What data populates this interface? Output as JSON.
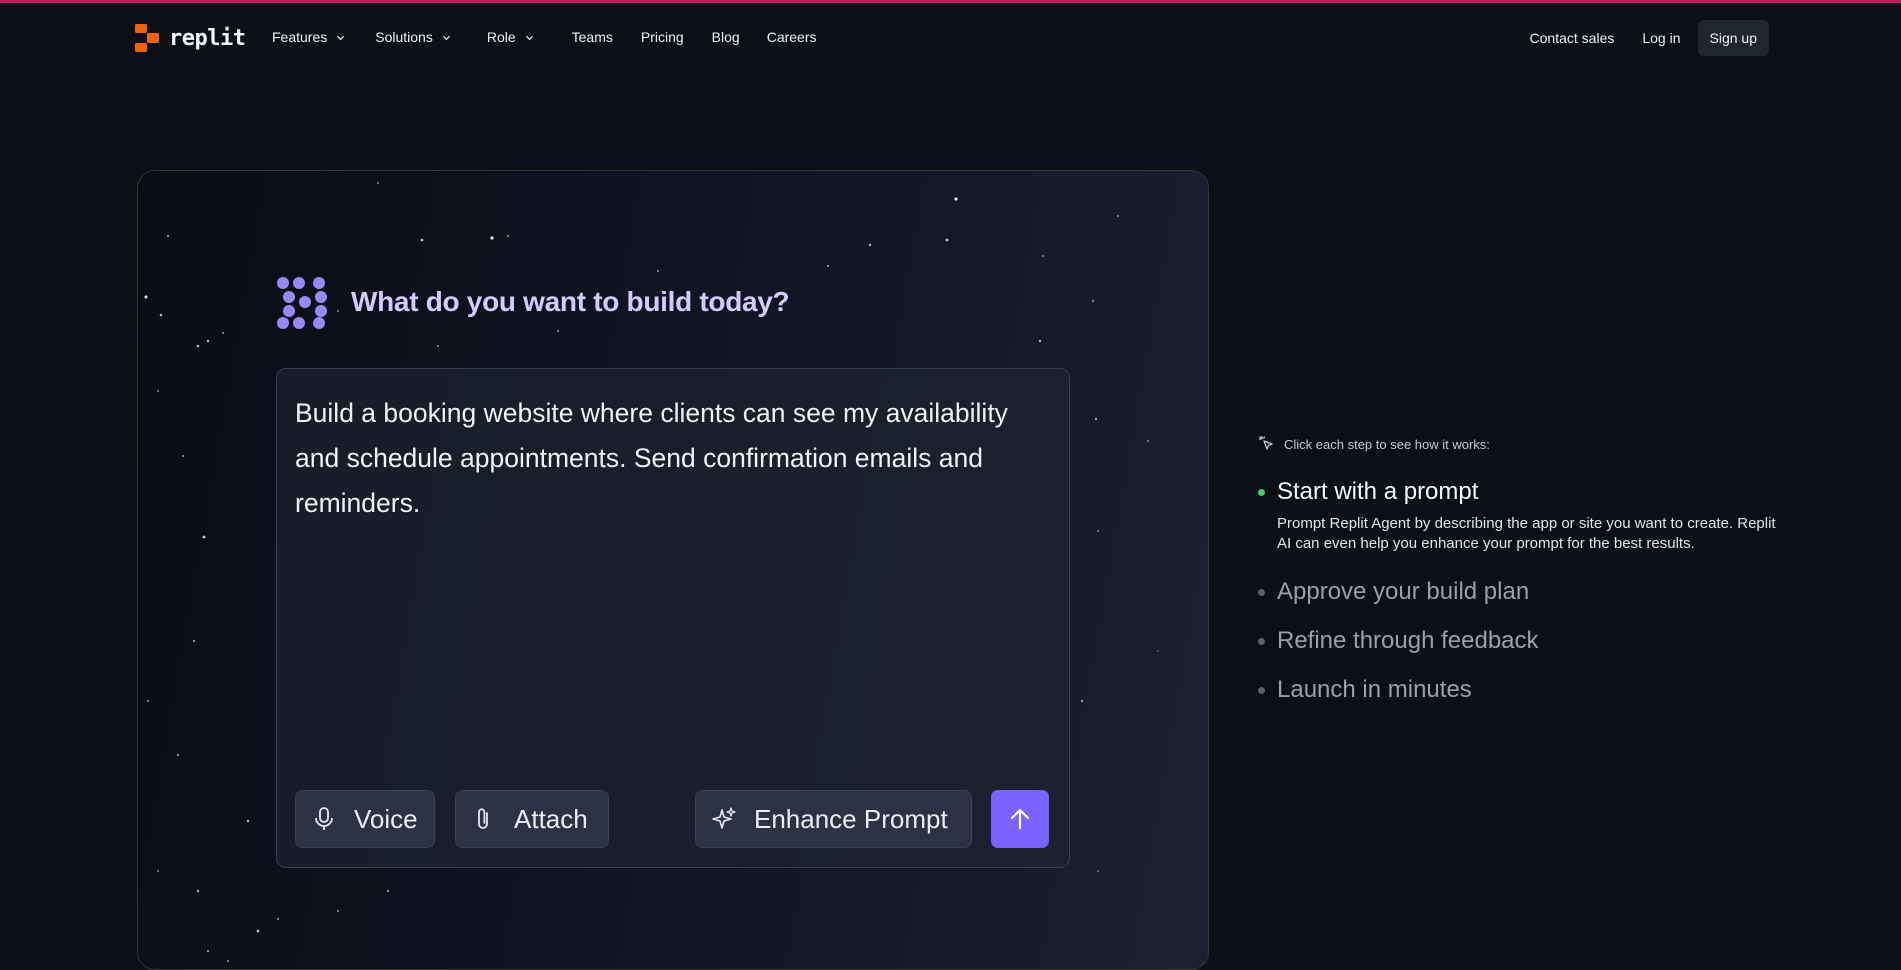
{
  "nav": {
    "logo_text": "replit",
    "links": [
      {
        "label": "Features",
        "dropdown": true
      },
      {
        "label": "Solutions",
        "dropdown": true
      },
      {
        "label": "Role",
        "dropdown": true
      },
      {
        "label": "Teams",
        "dropdown": false
      },
      {
        "label": "Pricing",
        "dropdown": false
      },
      {
        "label": "Blog",
        "dropdown": false
      },
      {
        "label": "Careers",
        "dropdown": false
      }
    ],
    "contact_sales": "Contact sales",
    "login": "Log in",
    "signup": "Sign up"
  },
  "demo": {
    "title": "What do you want to build today?",
    "prompt_text": "Build a booking website where clients can see my availability and schedule appointments. Send confirmation emails and reminders.",
    "voice_label": "Voice",
    "attach_label": "Attach",
    "enhance_label": "Enhance Prompt"
  },
  "steps": {
    "hint": "Click each step to see how it works:",
    "items": [
      {
        "title": "Start with a prompt",
        "description": "Prompt Replit Agent by describing the app or site you want to create. Replit AI can even help you enhance your prompt for the best results.",
        "active": true
      },
      {
        "title": "Approve your build plan",
        "active": false
      },
      {
        "title": "Refine through feedback",
        "active": false
      },
      {
        "title": "Launch in minutes",
        "active": false
      }
    ]
  },
  "colors": {
    "background": "#0b0f16",
    "brand_orange": "#f26207",
    "accent_purple": "#7b61ff",
    "active_dot": "#3ecf5c",
    "top_border": "#c2185b"
  },
  "icons": [
    "replit-logo-icon",
    "chevron-down-icon",
    "agent-icon",
    "microphone-icon",
    "paperclip-icon",
    "sparkles-icon",
    "arrow-up-icon",
    "cursor-click-icon"
  ]
}
